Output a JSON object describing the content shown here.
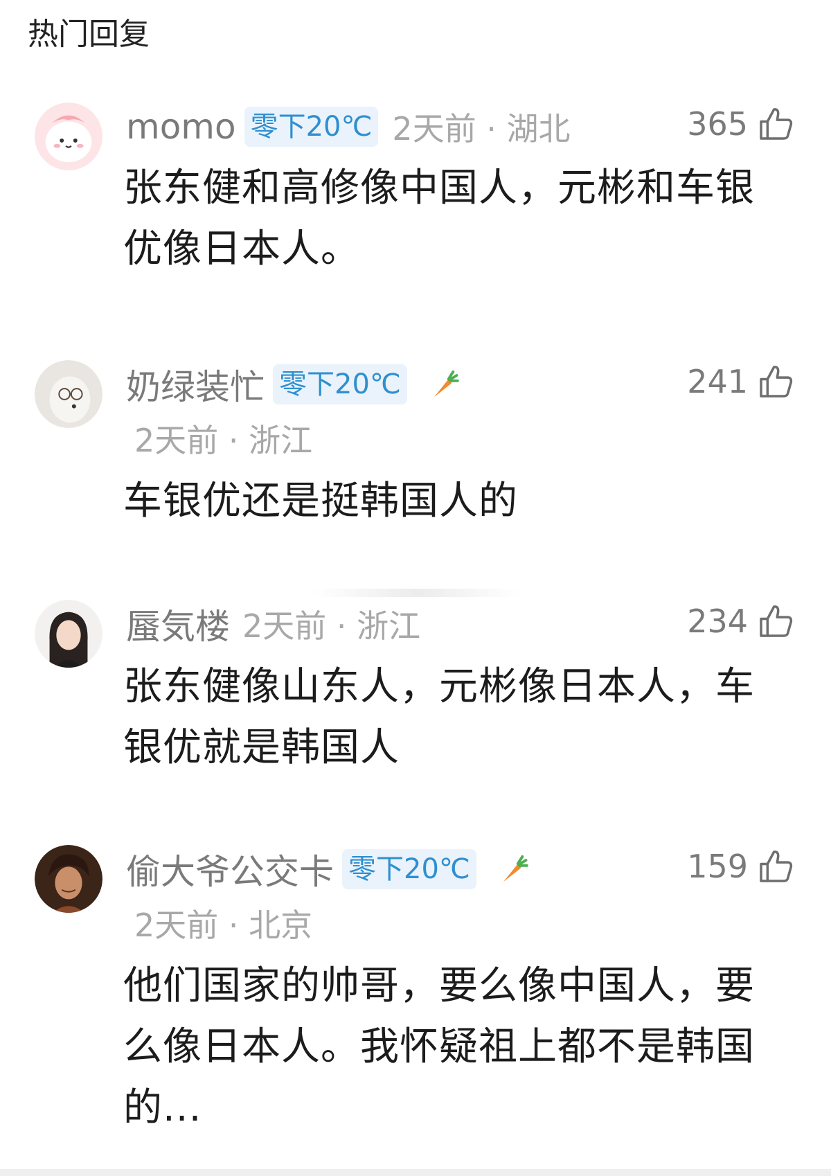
{
  "header": {
    "title": "热门回复"
  },
  "comments": [
    {
      "username": "momo",
      "badge": "零下20℃",
      "meta": "2天前 · 湖北",
      "likes": "365",
      "text": "张东健和高修像中国人，元彬和车银优像日本人。"
    },
    {
      "username": "奶绿装忙",
      "badge": "零下20℃",
      "meta": "2天前 · 浙江",
      "likes": "241",
      "text": "车银优还是挺韩国人的"
    },
    {
      "username": "蜃気楼",
      "meta": "2天前 · 浙江",
      "likes": "234",
      "text": "张东健像山东人，元彬像日本人，车银优就是韩国人"
    },
    {
      "username": "偷大爷公交卡",
      "badge": "零下20℃",
      "meta": "2天前 · 北京",
      "likes": "159",
      "text": "他们国家的帅哥，要么像中国人，要么像日本人。我怀疑祖上都不是韩国的..."
    }
  ],
  "icons": {
    "like": "thumb-up-icon",
    "badge_icon": "carrot-icon"
  },
  "colors": {
    "badge_text": "#2f8fd0",
    "badge_bg": "#eaf3fb",
    "meta": "#a8a8a8",
    "username": "#7a7a7a"
  }
}
